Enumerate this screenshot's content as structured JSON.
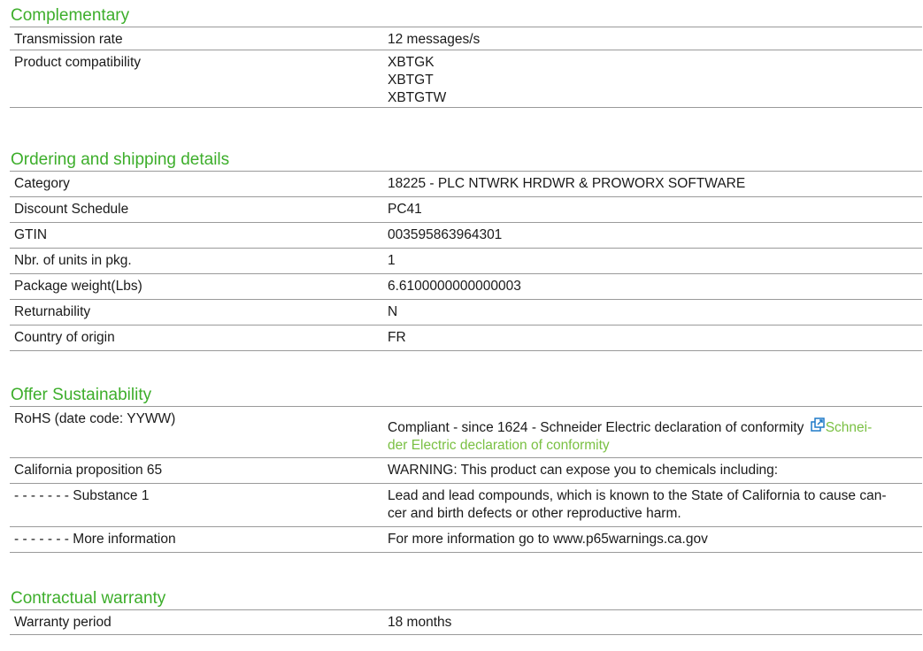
{
  "sections": {
    "complementary": {
      "title": "Complementary",
      "rows": [
        {
          "label": "Transmission rate",
          "value": "12 messages/s"
        },
        {
          "label": "Product compatibility",
          "values": [
            "XBTGK",
            "XBTGT",
            "XBTGTW"
          ]
        }
      ]
    },
    "ordering": {
      "title": "Ordering and shipping details",
      "rows": [
        {
          "label": "Category",
          "value": "18225 - PLC NTWRK HRDWR & PROWORX SOFTWARE"
        },
        {
          "label": "Discount Schedule",
          "value": "PC41"
        },
        {
          "label": "GTIN",
          "value": "003595863964301"
        },
        {
          "label": "Nbr. of units in pkg.",
          "value": "1"
        },
        {
          "label": "Package weight(Lbs)",
          "value": "6.6100000000000003"
        },
        {
          "label": "Returnability",
          "value": "N"
        },
        {
          "label": "Country of origin",
          "value": "FR"
        }
      ]
    },
    "sustainability": {
      "title": "Offer Sustainability",
      "rows": [
        {
          "label": "RoHS (date code: YYWW)",
          "value": "Compliant  - since  1624  -  Schneider Electric declaration of conformity",
          "link_line1": "Schnei-",
          "link_line2": "der Electric declaration of conformity",
          "icon": "external-link-icon"
        },
        {
          "label": "California proposition 65",
          "value": "WARNING: This product can expose you to chemicals including:"
        },
        {
          "label": "- - - - - - - Substance 1",
          "value_line1": "Lead and lead compounds, which is known to the State of California to cause can-",
          "value_line2": "cer and birth defects or other reproductive harm."
        },
        {
          "label": "- - - - - - - More information",
          "value": "For more information go to www.p65warnings.ca.gov"
        }
      ]
    },
    "warranty": {
      "title": "Contractual warranty",
      "rows": [
        {
          "label": "Warranty period",
          "value": "18 months"
        }
      ]
    }
  },
  "colors": {
    "heading": "#3dae2b",
    "link": "#7ac043",
    "rule": "#9a9a9a",
    "icon": "#1f7ac8"
  }
}
